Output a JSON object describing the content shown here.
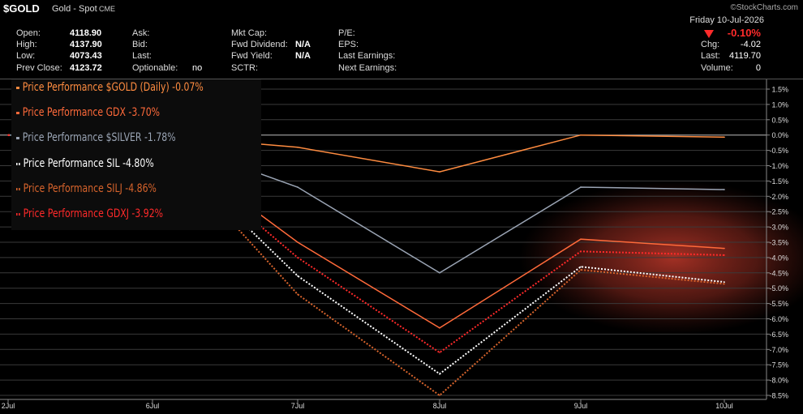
{
  "header": {
    "symbol": "$GOLD",
    "name": "Gold - Spot",
    "exchange": "CME",
    "credit": "©StockCharts.com",
    "date": "Friday  10-Jul-2026",
    "change_pct": "-0.10%",
    "change_color": "#ff2b2b"
  },
  "quote": {
    "open_label": "Open:",
    "open_value": "4118.90",
    "high_label": "High:",
    "high_value": "4137.90",
    "low_label": "Low:",
    "low_value": "4073.43",
    "prev_close_label": "Prev Close:",
    "prev_close_value": "4123.72",
    "ask_label": "Ask:",
    "bid_label": "Bid:",
    "last_label": "Last:",
    "optionable_label": "Optionable:",
    "optionable_value": "no",
    "mktcap_label": "Mkt Cap:",
    "fwd_dividend_label": "Fwd Dividend:",
    "fwd_dividend_value": "N/A",
    "fwd_yield_label": "Fwd Yield:",
    "fwd_yield_value": "N/A",
    "sctr_label": "SCTR:",
    "pe_label": "P/E:",
    "eps_label": "EPS:",
    "last_earnings_label": "Last Earnings:",
    "next_earnings_label": "Next Earnings:",
    "chg_label": "Chg:",
    "chg_value": "-4.02",
    "last_label2": "Last:",
    "last_value": "4119.70",
    "volume_label": "Volume:",
    "volume_value": "0"
  },
  "chart_data": {
    "type": "line",
    "x": [
      "2Jul",
      "6Jul",
      "7Jul",
      "8Jul",
      "9Jul",
      "10Jul"
    ],
    "y_ticks": [
      "1.5%",
      "1.0%",
      "0.5%",
      "0.0%",
      "-0.5%",
      "-1.0%",
      "-1.5%",
      "-2.0%",
      "-2.5%",
      "-3.0%",
      "-3.5%",
      "-4.0%",
      "-4.5%",
      "-5.0%",
      "-5.5%",
      "-6.0%",
      "-6.5%",
      "-7.0%",
      "-7.5%",
      "-8.0%",
      "-8.5%"
    ],
    "ylim": [
      -8.5,
      1.5
    ],
    "grid": true,
    "legend_position": "top-left",
    "series": [
      {
        "name": "Price Performance $GOLD (Daily) -0.07%",
        "color": "#ff8c40",
        "style": "solid",
        "values": [
          0,
          0,
          -0.4,
          -1.2,
          0,
          -0.07
        ]
      },
      {
        "name": "Price Performance GDX -3.70%",
        "color": "#ff6a3a",
        "style": "solid",
        "values": [
          0,
          0,
          -3.5,
          -6.3,
          -3.4,
          -3.7
        ]
      },
      {
        "name": "Price Performance $SILVER -1.78%",
        "color": "#9aa4b4",
        "style": "solid",
        "values": [
          0,
          0,
          -1.7,
          -4.5,
          -1.7,
          -1.78
        ]
      },
      {
        "name": "Price Performance SIL -4.80%",
        "color": "#ffffff",
        "style": "dotted",
        "values": [
          0,
          0,
          -4.6,
          -7.8,
          -4.3,
          -4.8
        ]
      },
      {
        "name": "Price Performance SILJ -4.86%",
        "color": "#d8642c",
        "style": "dotted",
        "values": [
          0,
          0,
          -5.2,
          -8.5,
          -4.4,
          -4.86
        ]
      },
      {
        "name": "Price Performance GDXJ -3.92%",
        "color": "#ff2a2a",
        "style": "dotted",
        "values": [
          0,
          0,
          -4.0,
          -7.1,
          -3.8,
          -3.92
        ]
      }
    ]
  }
}
